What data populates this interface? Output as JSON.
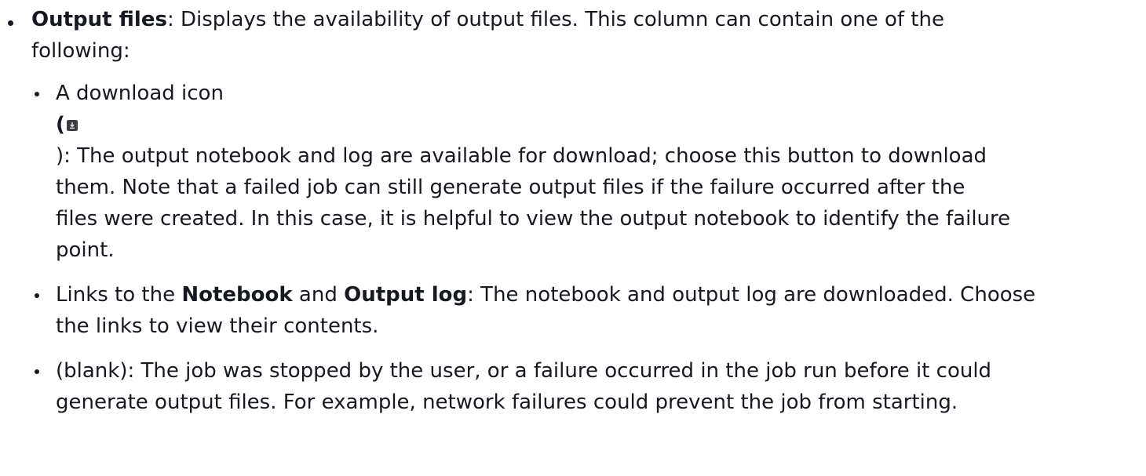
{
  "item": {
    "term": "Output files",
    "line1_rest": ": Displays the availability of output files. This column can contain one of the",
    "line2": "following:"
  },
  "options": [
    {
      "lead": "A download icon",
      "open_paren": "(",
      "icon": "download-icon",
      "lines": [
        "): The output notebook and log are available for download; choose this button to download",
        "them. Note that a failed job can still generate output files if the failure occurred after the",
        "files were created. In this case, it is helpful to view the output notebook to identify the failure",
        "point."
      ]
    },
    {
      "prefix": "Links to the ",
      "bold1": "Notebook",
      "mid": " and ",
      "bold2": "Output log",
      "rest1": ": The notebook and output log are downloaded. Choose",
      "line2": "the links to view their contents."
    },
    {
      "line1": "(blank): The job was stopped by the user, or a failure occurred in the job run before it could",
      "line2": "generate output files. For example, network failures could prevent the job from starting."
    }
  ]
}
